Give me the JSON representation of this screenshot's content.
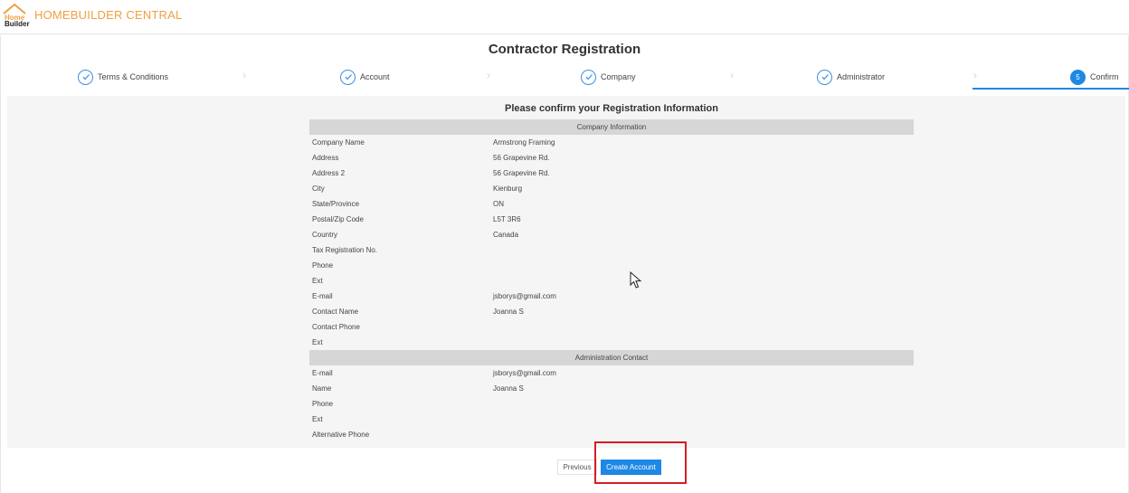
{
  "header": {
    "logo_top": "Home",
    "logo_bottom": "Builder",
    "brand": "HOMEBUILDER CENTRAL",
    "brand_color": "#f0a040"
  },
  "page_title": "Contractor Registration",
  "steps": [
    {
      "label": "Terms & Conditions",
      "state": "done"
    },
    {
      "label": "Account",
      "state": "done"
    },
    {
      "label": "Company",
      "state": "done"
    },
    {
      "label": "Administrator",
      "state": "done"
    },
    {
      "label": "Confirm",
      "state": "active",
      "number": "5"
    }
  ],
  "confirm_title": "Please confirm your Registration Information",
  "company_section": {
    "title": "Company Information",
    "rows": [
      {
        "label": "Company Name",
        "value": "Armstrong Framing"
      },
      {
        "label": "Address",
        "value": "56 Grapevine Rd."
      },
      {
        "label": "Address 2",
        "value": "56 Grapevine Rd."
      },
      {
        "label": "City",
        "value": "Kienburg"
      },
      {
        "label": "State/Province",
        "value": "ON"
      },
      {
        "label": "Postal/Zip Code",
        "value": "L5T 3R6"
      },
      {
        "label": "Country",
        "value": "Canada"
      },
      {
        "label": "Tax Registration No.",
        "value": ""
      },
      {
        "label": "Phone",
        "value": ""
      },
      {
        "label": "Ext",
        "value": ""
      },
      {
        "label": "E-mail",
        "value": "jsborys@gmail.com"
      },
      {
        "label": "Contact Name",
        "value": "Joanna S"
      },
      {
        "label": "Contact Phone",
        "value": ""
      },
      {
        "label": "Ext",
        "value": ""
      }
    ]
  },
  "admin_section": {
    "title": "Administration Contact",
    "rows": [
      {
        "label": "E-mail",
        "value": "jsborys@gmail.com"
      },
      {
        "label": "Name",
        "value": "Joanna S"
      },
      {
        "label": "Phone",
        "value": ""
      },
      {
        "label": "Ext",
        "value": ""
      },
      {
        "label": "Alternative Phone",
        "value": ""
      }
    ]
  },
  "buttons": {
    "previous": "Previous",
    "create": "Create Account"
  },
  "colors": {
    "accent": "#1e88e5",
    "highlight": "#d21f24"
  }
}
